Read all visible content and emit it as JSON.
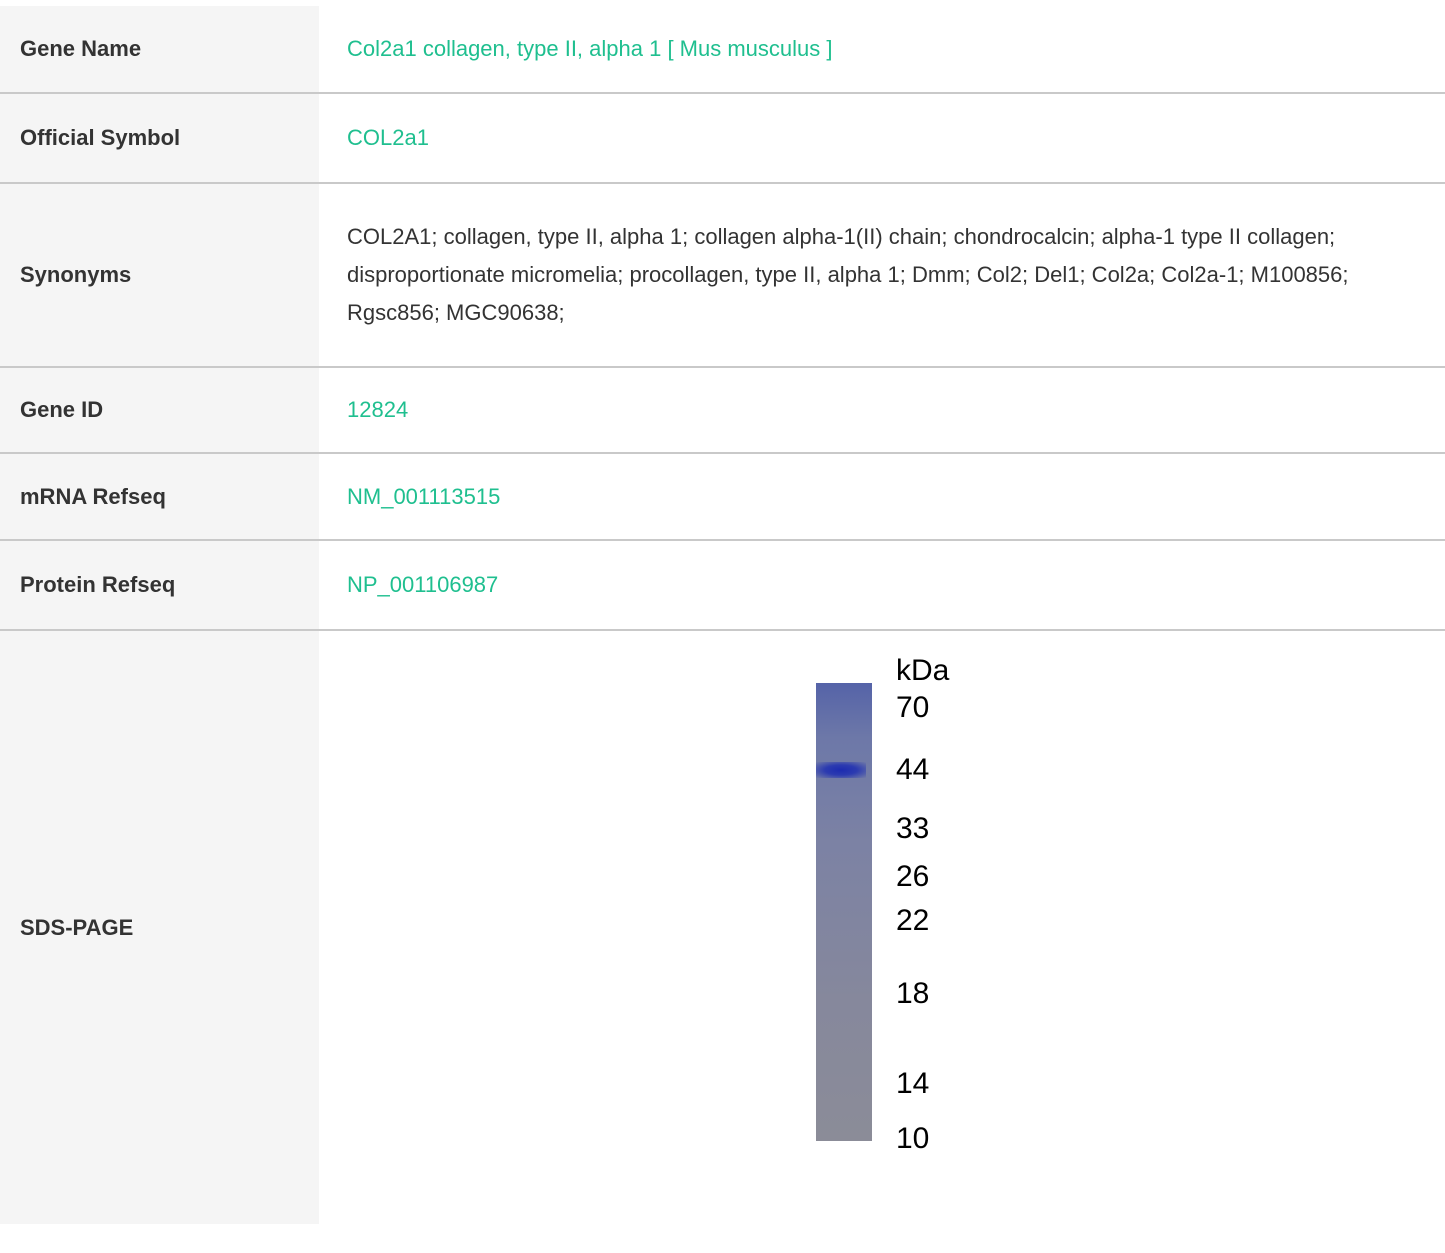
{
  "rows": {
    "gene_name": {
      "label": "Gene Name",
      "value": "Col2a1 collagen, type II, alpha 1 [ Mus musculus ]"
    },
    "official_symbol": {
      "label": "Official Symbol",
      "value": "COL2a1"
    },
    "synonyms": {
      "label": "Synonyms",
      "value": "COL2A1; collagen, type II, alpha 1; collagen alpha-1(II) chain; chondrocalcin; alpha-1 type II collagen; disproportionate micromelia; procollagen, type II, alpha 1; Dmm; Col2; Del1; Col2a; Col2a-1; M100856; Rgsc856; MGC90638;"
    },
    "gene_id": {
      "label": "Gene ID",
      "value": "12824"
    },
    "mrna_refseq": {
      "label": "mRNA Refseq",
      "value": "NM_001113515"
    },
    "protein_refseq": {
      "label": "Protein Refseq",
      "value": "NP_001106987"
    },
    "sds_page": {
      "label": "SDS-PAGE"
    }
  },
  "gel": {
    "unit": "kDa",
    "markers": [
      "70",
      "44",
      "33",
      "26",
      "22",
      "18",
      "14",
      "10"
    ]
  },
  "colors": {
    "link": "#1fbf8f",
    "label_bg": "#f5f5f5",
    "divider": "#c9c9c9"
  }
}
